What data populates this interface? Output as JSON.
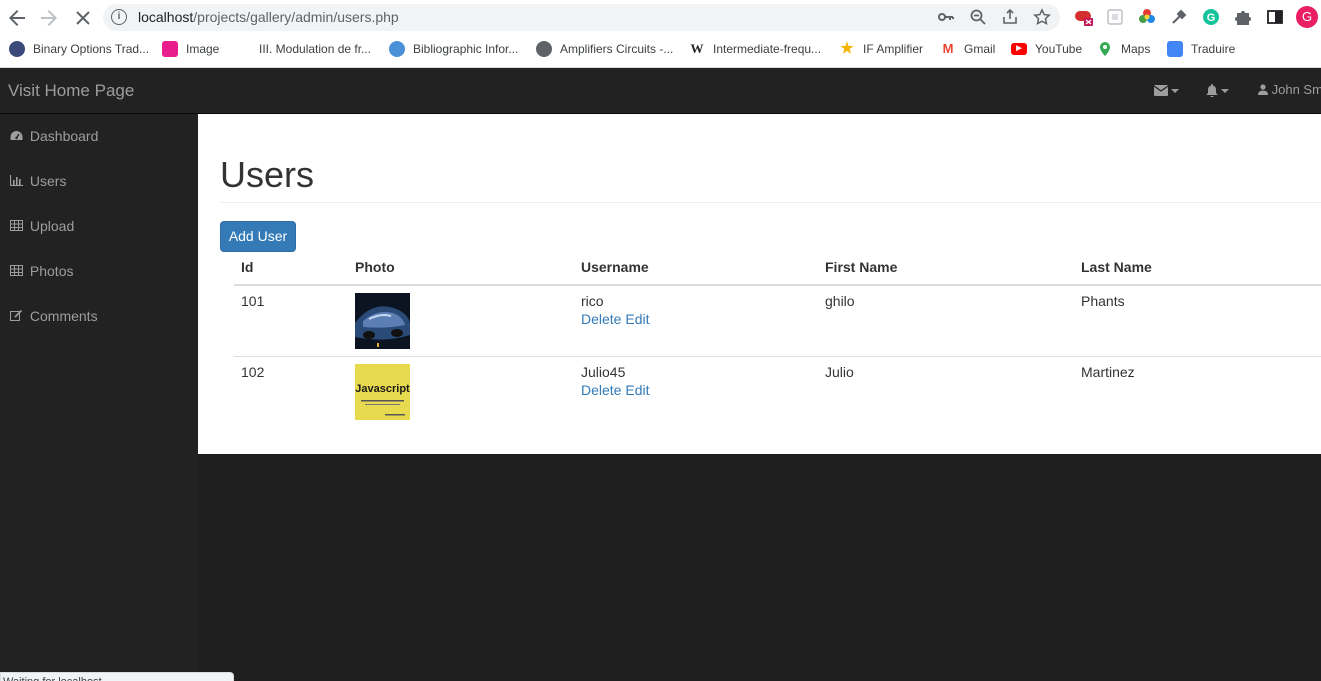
{
  "browser": {
    "url_host": "localhost",
    "url_path": "/projects/gallery/admin/users.php",
    "profile_initial": "G",
    "bookmarks": [
      {
        "label": "Binary Options Trad...",
        "icon": "binary-options-favicon",
        "color": "#3b4a7a"
      },
      {
        "label": "Image",
        "icon": "image-favicon",
        "color": "#e91e8c"
      },
      {
        "label": "III. Modulation de fr...",
        "icon": "",
        "color": ""
      },
      {
        "label": "Bibliographic Infor...",
        "icon": "cloud-favicon",
        "color": "#4a90d9"
      },
      {
        "label": "Amplifiers Circuits -...",
        "icon": "globe-favicon",
        "color": "#5f6368"
      },
      {
        "label": "Intermediate-frequ...",
        "icon": "wikipedia-favicon",
        "color": "#222222"
      },
      {
        "label": "IF Amplifier",
        "icon": "star-favicon",
        "color": "#f5b400"
      },
      {
        "label": "Gmail",
        "icon": "gmail-favicon",
        "color": "#ea4335"
      },
      {
        "label": "YouTube",
        "icon": "youtube-favicon",
        "color": "#ff0000"
      },
      {
        "label": "Maps",
        "icon": "maps-favicon",
        "color": "#34a853"
      },
      {
        "label": "Traduire",
        "icon": "translate-favicon",
        "color": "#4285f4"
      }
    ],
    "status_text": "Waiting for localhost..."
  },
  "navbar": {
    "brand": "Visit Home Page",
    "user_name": "John Sm"
  },
  "sidebar": {
    "items": [
      {
        "label": "Dashboard",
        "icon": "dashboard-icon"
      },
      {
        "label": "Users",
        "icon": "bar-chart-icon"
      },
      {
        "label": "Upload",
        "icon": "table-icon"
      },
      {
        "label": "Photos",
        "icon": "table-icon"
      },
      {
        "label": "Comments",
        "icon": "edit-icon"
      }
    ]
  },
  "main": {
    "title": "Users",
    "add_button": "Add User",
    "columns": [
      "Id",
      "Photo",
      "Username",
      "First Name",
      "Last Name"
    ],
    "rows": [
      {
        "id": "101",
        "photo": "car-photo",
        "username": "rico",
        "first_name": "ghilo",
        "last_name": "Phants"
      },
      {
        "id": "102",
        "photo": "javascript-book-photo",
        "photo_text": "Javascript",
        "username": "Julio45",
        "first_name": "Julio",
        "last_name": "Martinez"
      }
    ],
    "row_actions": {
      "delete": "Delete",
      "edit": "Edit"
    }
  }
}
